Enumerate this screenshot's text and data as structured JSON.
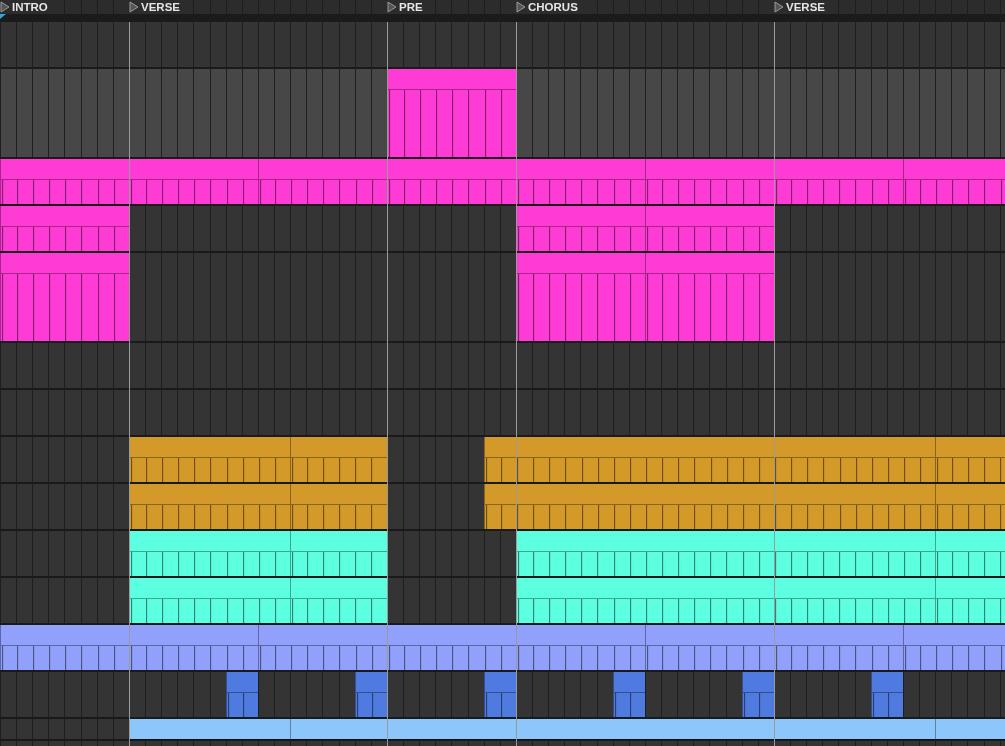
{
  "locators": [
    {
      "label": "INTRO"
    },
    {
      "label": "VERSE"
    },
    {
      "label": "PRE"
    },
    {
      "label": "CHORUS"
    },
    {
      "label": "VERSE"
    }
  ],
  "tracks": [
    {
      "kind": "normal",
      "selected": false
    },
    {
      "kind": "tall",
      "selected": true,
      "color": "#ff3bd6"
    },
    {
      "kind": "normal",
      "color": "#ff3bd6"
    },
    {
      "kind": "normal",
      "selected": false,
      "color": "#ff3bd6"
    },
    {
      "kind": "tall",
      "selected": false,
      "color": "#ff3bd6"
    },
    {
      "kind": "normal",
      "selected": false
    },
    {
      "kind": "normal",
      "selected": false
    },
    {
      "kind": "normal",
      "selected": false,
      "color": "#d39a2a"
    },
    {
      "kind": "normal",
      "selected": false,
      "color": "#d39a2a"
    },
    {
      "kind": "normal",
      "selected": false,
      "color": "#5cffe0"
    },
    {
      "kind": "normal",
      "selected": false,
      "color": "#5cffe0"
    },
    {
      "kind": "normal",
      "color": "#90a0fb"
    },
    {
      "kind": "normal",
      "selected": false,
      "color": "#4f7ae0"
    },
    {
      "kind": "folded",
      "selected": false,
      "color": "#8cc6fb"
    },
    {
      "kind": "normal",
      "selected": false
    }
  ]
}
